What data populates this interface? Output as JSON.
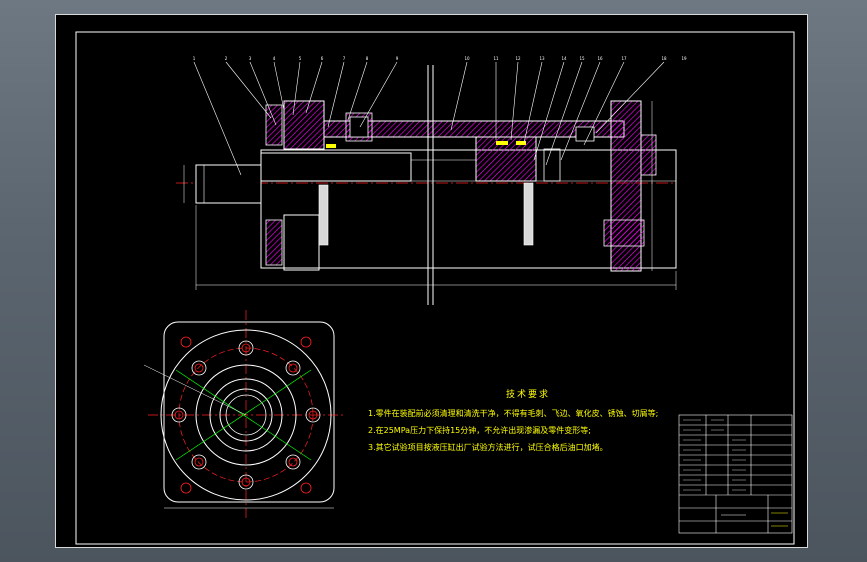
{
  "technical_requirements": {
    "title": "技术要求",
    "notes": [
      "1.零件在装配前必须清理和清洗干净，不得有毛刺、飞边、氧化皮、锈蚀、切屑等;",
      "2.在25MPa压力下保持15分钟，不允许出现渗漏及零件变形等;",
      "3.其它试验项目按液压缸出厂试验方法进行，试压合格后油口加堵。"
    ]
  },
  "balloons": [
    "1",
    "2",
    "3",
    "4",
    "5",
    "6",
    "7",
    "8",
    "9",
    "10",
    "11",
    "12",
    "13",
    "14",
    "15",
    "16",
    "17",
    "18",
    "19"
  ],
  "colors": {
    "outline": "#ffffff",
    "hatch": "#ff00ff",
    "centerline": "#ff2020",
    "annotation": "#ffff00",
    "cylinder_fill": "#cfcfcf",
    "leader": "#ffffff"
  }
}
